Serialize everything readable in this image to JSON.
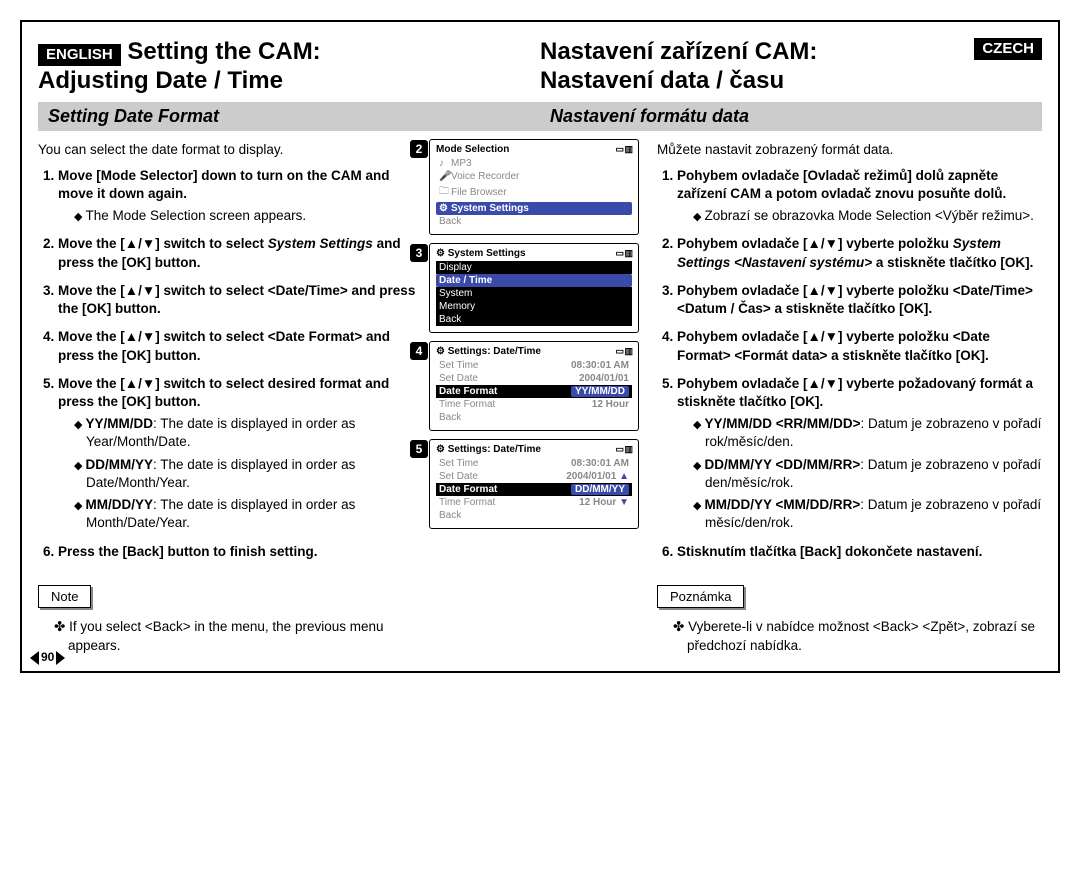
{
  "page_number": "90",
  "en": {
    "lang": "ENGLISH",
    "title1": "Setting the CAM:",
    "title2": "Adjusting Date / Time",
    "subhead": "Setting Date Format",
    "intro": "You can select the date format to display.",
    "steps": [
      {
        "text": "Move [Mode Selector] down to turn on the CAM and move it down again.",
        "subs": [
          "The Mode Selection screen appears."
        ]
      },
      {
        "text": "Move the [▲/▼] switch to select ",
        "em": "System Settings",
        "text2": " and press the [OK] button."
      },
      {
        "text": "Move the [▲/▼] switch to select <Date/Time> and press the [OK] button."
      },
      {
        "text": "Move the [▲/▼] switch to select <Date Format> and press the [OK] button."
      },
      {
        "text": "Move the [▲/▼] switch to select desired format and press the [OK] button.",
        "subs": [
          {
            "k": "YY/MM/DD",
            "v": ": The date is displayed in order as Year/Month/Date."
          },
          {
            "k": "DD/MM/YY",
            "v": ": The date is displayed in order as Date/Month/Year."
          },
          {
            "k": "MM/DD/YY",
            "v": ": The date is displayed in order as Month/Date/Year."
          }
        ]
      },
      {
        "text": "Press the [Back] button to finish setting."
      }
    ],
    "note_label": "Note",
    "note": "If you select <Back> in the menu, the previous menu appears."
  },
  "cz": {
    "lang": "CZECH",
    "title1": "Nastavení zařízení CAM:",
    "title2": "Nastavení data / času",
    "subhead": "Nastavení formátu data",
    "intro": "Můžete nastavit zobrazený formát data.",
    "steps": [
      {
        "text": "Pohybem ovladače [Ovladač režimů] dolů zapněte zařízení CAM a potom ovladač znovu posuňte dolů.",
        "subs": [
          "Zobrazí se obrazovka Mode Selection <Výběr režimu>."
        ]
      },
      {
        "text": "Pohybem ovladače [▲/▼] vyberte položku ",
        "em": "System Settings <Nastavení systému>",
        "text2": " a stiskněte tlačítko [OK]."
      },
      {
        "text": "Pohybem ovladače [▲/▼] vyberte položku <Date/Time> <Datum / Čas> a stiskněte tlačítko [OK]."
      },
      {
        "text": "Pohybem ovladače [▲/▼] vyberte položku <Date Format> <Formát data> a stiskněte tlačítko [OK]."
      },
      {
        "text": "Pohybem ovladače [▲/▼] vyberte požadovaný formát a stiskněte tlačítko [OK].",
        "subs": [
          {
            "k": "YY/MM/DD <RR/MM/DD>",
            "v": ": Datum je zobrazeno v pořadí rok/měsíc/den."
          },
          {
            "k": "DD/MM/YY <DD/MM/RR>",
            "v": ": Datum je zobrazeno v pořadí den/měsíc/rok."
          },
          {
            "k": "MM/DD/YY <MM/DD/RR>",
            "v": ": Datum je zobrazeno v pořadí měsíc/den/rok."
          }
        ]
      },
      {
        "text": "Stisknutím tlačítka [Back] dokončete nastavení."
      }
    ],
    "note_label": "Poznámka",
    "note": "Vyberete-li v nabídce možnost <Back> <Zpět>, zobrazí se předchozí nabídka."
  },
  "screens": {
    "s2": {
      "num": "2",
      "title": "Mode Selection",
      "items": [
        "MP3",
        "Voice Recorder",
        "File Browser",
        "System Settings",
        "Back"
      ],
      "sel": 3
    },
    "s3": {
      "num": "3",
      "title": "System Settings",
      "items": [
        "Display",
        "Date / Time",
        "System",
        "Memory",
        "Back"
      ],
      "sel": 1
    },
    "s4": {
      "num": "4",
      "title": "Settings: Date/Time",
      "rows": [
        {
          "k": "Set Time",
          "v": "08:30:01 AM"
        },
        {
          "k": "Set Date",
          "v": "2004/01/01"
        },
        {
          "k": "Date Format",
          "v": "YY/MM/DD",
          "sel": true
        },
        {
          "k": "Time Format",
          "v": "12 Hour"
        },
        {
          "k": "Back",
          "v": ""
        }
      ]
    },
    "s5": {
      "num": "5",
      "title": "Settings: Date/Time",
      "rows": [
        {
          "k": "Set Time",
          "v": "08:30:01 AM"
        },
        {
          "k": "Set Date",
          "v": "2004/01/01"
        },
        {
          "k": "Date Format",
          "v": "DD/MM/YY",
          "sel": true
        },
        {
          "k": "Time Format",
          "v": "12 Hour"
        },
        {
          "k": "Back",
          "v": ""
        }
      ]
    }
  }
}
